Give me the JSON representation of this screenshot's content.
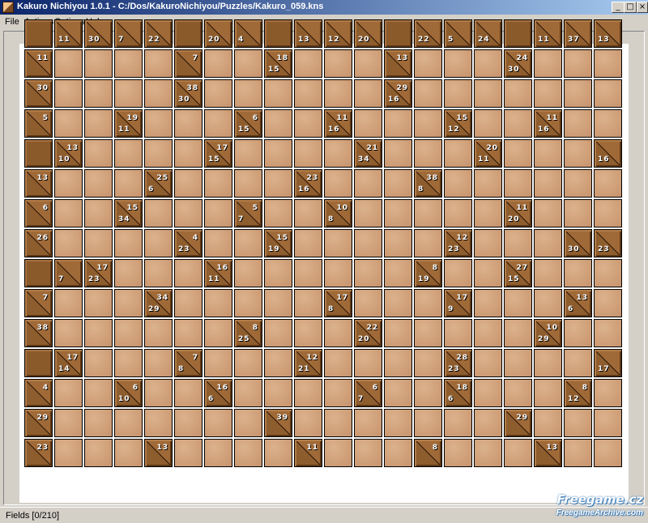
{
  "window": {
    "title": "Kakuro Nichiyou 1.0.1 - C:/Dos/KakuroNichiyou/Puzzles/Kakuro_059.kns",
    "minimize": "_",
    "maximize": "□",
    "close": "×"
  },
  "menu": [
    "File",
    "Actions",
    "Options",
    "Help"
  ],
  "status": {
    "text": "Fields [0/210]"
  },
  "watermark": {
    "line1": "Freegame.cz",
    "line2": "FreegameArchive.com"
  },
  "board": {
    "cols": 20,
    "rows": 15,
    "selected_cell": {
      "row": 10,
      "col": 17
    },
    "legend": "Each row string lists 20 cells. '#' = solid block, '.' = empty entry cell, 'D\\A' = clue (D = down sum below diagonal, A = across sum above diagonal, 0 = none).",
    "rows_data": [
      "#|11\\0|30\\0|7\\0|22\\0|#|20\\0|4\\0|#|13\\0|12\\0|20\\0|#|22\\0|5\\0|24\\0|#|11\\0|37\\0|13\\0",
      "0\\11|.|.|.|.|0\\7|.|.|15\\18|.|.|.|0\\13|.|.|.|30\\24|.|.|.",
      "0\\30|.|.|.|.|30\\38|.|.|.|.|.|.|16\\29|.|.|.|.|.|.|.",
      "0\\5|.|.|11\\19|.|.|.|15\\6|.|.|16\\11|.|.|.|12\\15|.|.|16\\11|.|.",
      "#|10\\13|.|.|.|.|15\\17|.|.|.|.|34\\21|.|.|.|11\\20|.|.|.|16\\0",
      "0\\13|.|.|.|6\\25|.|.|.|.|16\\23|.|.|.|8\\38|.|.|.|.|.|.",
      "0\\6|.|.|34\\15|.|.|.|7\\5|.|.|8\\10|.|.|.|.|.|20\\11|.|.|.",
      "0\\26|.|.|.|.|23\\4|.|.|19\\15|.|.|.|.|.|23\\12|.|.|.|30\\0|23\\0",
      "#|7\\0|23\\17|.|.|.|11\\16|.|.|.|.|.|.|19\\8|.|.|15\\27|.|.|.",
      "0\\7|.|.|.|29\\34|.|.|.|.|.|8\\17|.|.|.|9\\17|.|.|.|6\\13|.",
      "0\\38|.|.|.|.|.|.|25\\8|.|.|.|20\\22|.|.|.|.|.|29\\10|.|.",
      "#|14\\17|.|.|.|8\\7|.|.|.|21\\12|.|.|.|.|23\\28|.|.|.|.|17\\0",
      "0\\4|.|.|10\\6|.|.|6\\16|.|.|.|.|7\\6|.|.|6\\18|.|.|.|12\\8|.",
      "0\\29|.|.|.|.|.|.|.|0\\39|.|.|.|.|.|.|.|0\\29|.|.|.",
      "0\\23|.|.|.|0\\13|.|.|.|.|0\\11|.|.|.|0\\8|.|.|.|0\\13|.|."
    ]
  }
}
